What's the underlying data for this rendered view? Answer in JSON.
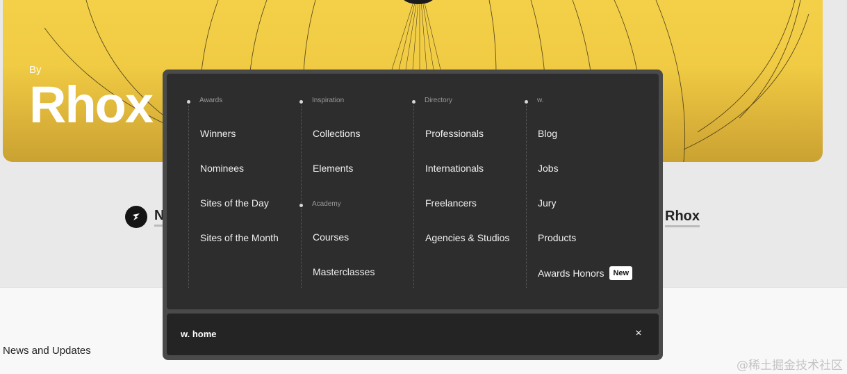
{
  "hero": {
    "by": "By",
    "title": "Rhox"
  },
  "author_left": {
    "name": "N"
  },
  "author_right": {
    "name": "Rhox"
  },
  "lower": {
    "section_title": "News and Updates"
  },
  "watermark": "@稀土掘金技术社区",
  "menu": {
    "columns": [
      {
        "category": "Awards",
        "items": [
          "Winners",
          "Nominees",
          "Sites of the Day",
          "Sites of the Month"
        ]
      },
      {
        "category": "Inspiration",
        "items": [
          "Collections",
          "Elements"
        ],
        "subcategory": "Academy",
        "subitems": [
          "Courses",
          "Masterclasses"
        ]
      },
      {
        "category": "Directory",
        "items": [
          "Professionals",
          "Internationals",
          "Freelancers",
          "Agencies & Studios"
        ]
      },
      {
        "category": "w.",
        "items": [
          "Blog",
          "Jobs",
          "Jury",
          "Products",
          "Awards Honors"
        ],
        "badge": "New"
      }
    ],
    "footer": {
      "home_label": "w. home",
      "close_icon": "close-icon",
      "close_glyph": "×"
    }
  }
}
